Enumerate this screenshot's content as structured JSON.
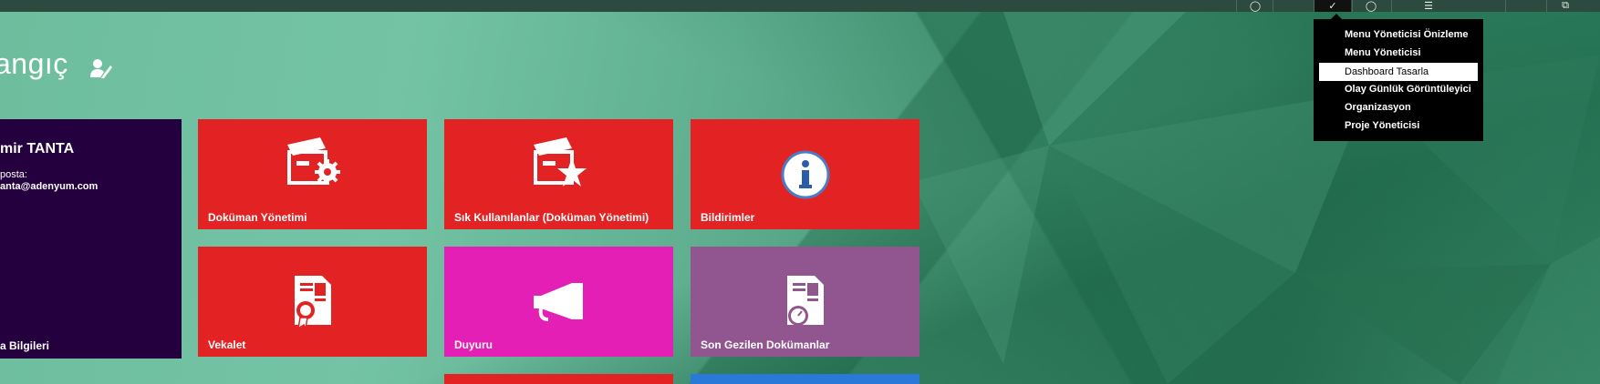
{
  "header": {
    "title": "angıç",
    "edit_icon": "user-edit-icon"
  },
  "profile": {
    "name": "mir TANTA",
    "email_label": "posta:",
    "email": "anta@adenyum.com",
    "footer": "a Bilgileri"
  },
  "tiles": [
    {
      "label": "Doküman Yönetimi",
      "icon": "document-box-gear-icon",
      "color": "#e32323"
    },
    {
      "label": "Sık Kullanılanlar (Doküman Yönetimi)",
      "icon": "document-box-star-icon",
      "color": "#e32323"
    },
    {
      "label": "Bildirimler",
      "icon": "info-icon",
      "color": "#e32323"
    },
    {
      "label": "Vekalet",
      "icon": "certificate-icon",
      "color": "#e32323"
    },
    {
      "label": "Duyuru",
      "icon": "megaphone-icon",
      "color": "#e31fb5"
    },
    {
      "label": "Son Gezilen Dokümanlar",
      "icon": "document-timer-icon",
      "color": "#91558f"
    }
  ],
  "dropdown": {
    "items": [
      "Menu Yöneticisi Önizleme",
      "Menu Yöneticisi",
      "Dashboard Tasarla",
      "Olay Günlük Görüntüleyici",
      "Organizasyon",
      "Proje Yöneticisi"
    ],
    "selected": "Dashboard Tasarla"
  },
  "colors": {
    "profile_bg": "#24003f",
    "topbar_bg": "#2c4a40",
    "menu_bg": "#000000"
  }
}
